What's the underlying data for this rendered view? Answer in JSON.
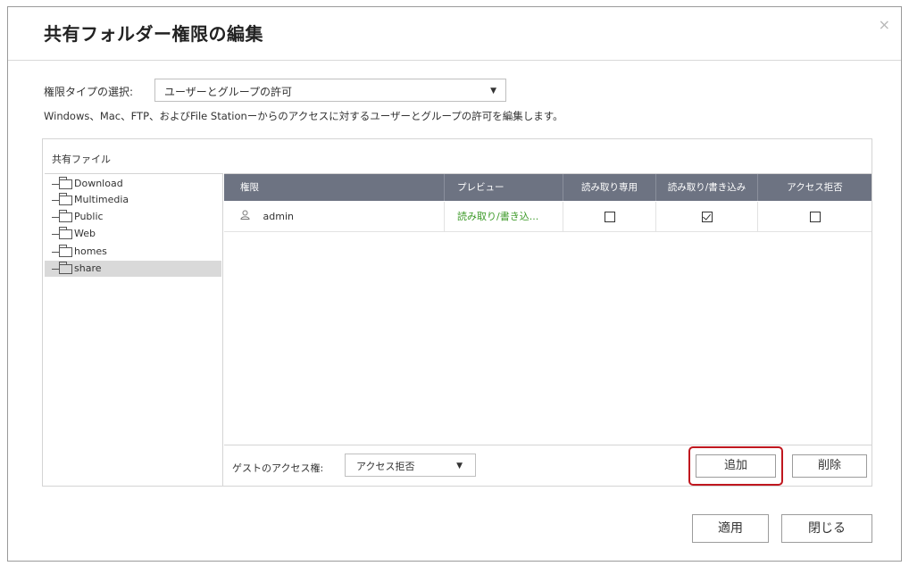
{
  "dialog": {
    "title": "共有フォルダー権限の編集",
    "close_glyph": "×"
  },
  "permission_type": {
    "label": "権限タイプの選択:",
    "selected": "ユーザーとグループの許可"
  },
  "description": "Windows、Mac、FTP、およびFile Stationーからのアクセスに対するユーザーとグループの許可を編集します。",
  "shared_files": {
    "header": "共有ファイル",
    "folders": [
      {
        "name": "Download",
        "selected": false
      },
      {
        "name": "Multimedia",
        "selected": false
      },
      {
        "name": "Public",
        "selected": false
      },
      {
        "name": "Web",
        "selected": false
      },
      {
        "name": "homes",
        "selected": false
      },
      {
        "name": "share",
        "selected": true
      }
    ]
  },
  "permissions_table": {
    "columns": [
      "権限",
      "プレビュー",
      "読み取り専用",
      "読み取り/書き込み",
      "アクセス拒否"
    ],
    "rows": [
      {
        "name": "admin",
        "preview": "読み取り/書き込...",
        "read_only": false,
        "read_write": true,
        "deny": false
      }
    ],
    "header_color": "#6d7382",
    "preview_color": "#3c9a28"
  },
  "guest_access": {
    "label": "ゲストのアクセス権:",
    "selected": "アクセス拒否"
  },
  "buttons": {
    "add": "追加",
    "delete": "削除",
    "apply": "適用",
    "close": "閉じる"
  },
  "highlight_color": "#c0171f"
}
